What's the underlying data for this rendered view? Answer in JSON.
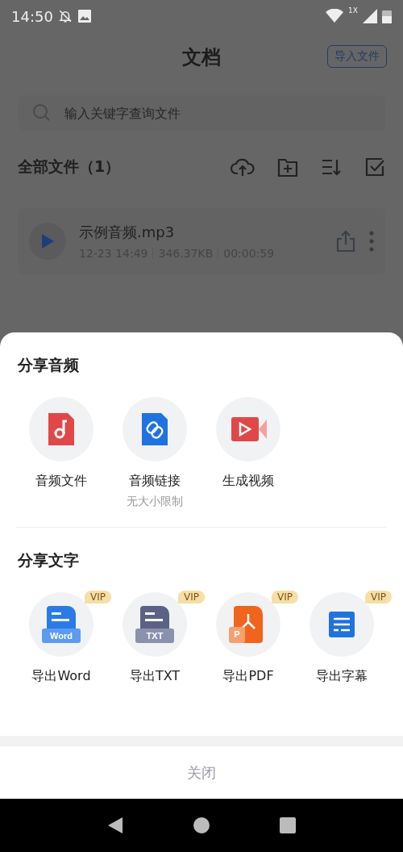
{
  "status_bar": {
    "time": "14:50",
    "network_label": "1X"
  },
  "header": {
    "title": "文档",
    "import_button": "导入文件"
  },
  "search": {
    "placeholder": "输入关键字查询文件"
  },
  "files_section": {
    "title": "全部文件（1）"
  },
  "files": [
    {
      "name": "示例音频.mp3",
      "date": "12-23 14:49",
      "size": "346.37KB",
      "duration": "00:00:59"
    }
  ],
  "share_sheet": {
    "sections": [
      {
        "title": "分享音频",
        "items": [
          {
            "kind": "audio_file",
            "label": "音频文件"
          },
          {
            "kind": "link",
            "label": "音频链接",
            "note": "无大小限制"
          },
          {
            "kind": "video",
            "label": "生成视频"
          }
        ]
      },
      {
        "title": "分享文字",
        "items": [
          {
            "kind": "word",
            "label": "导出Word",
            "icon_text": "Word",
            "badge": "VIP"
          },
          {
            "kind": "txt",
            "label": "导出TXT",
            "icon_text": "TXT",
            "badge": "VIP"
          },
          {
            "kind": "pdf",
            "label": "导出PDF",
            "icon_text": "P",
            "badge": "VIP"
          },
          {
            "kind": "subtitle",
            "label": "导出字幕",
            "badge": "VIP"
          }
        ]
      }
    ],
    "close_button": "关闭"
  }
}
